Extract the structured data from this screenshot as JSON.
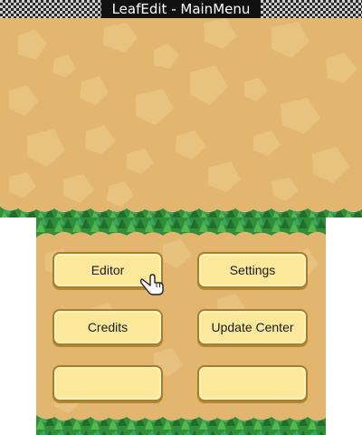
{
  "window": {
    "title": "LeafEdit - MainMenu"
  },
  "menu": {
    "editor_label": "Editor",
    "settings_label": "Settings",
    "credits_label": "Credits",
    "update_center_label": "Update Center",
    "empty_left_label": "",
    "empty_right_label": ""
  },
  "colors": {
    "sand": "#e2b66e",
    "grass": "#2f8f3a",
    "button": "#fde99a",
    "button_border": "#a97d2a"
  }
}
